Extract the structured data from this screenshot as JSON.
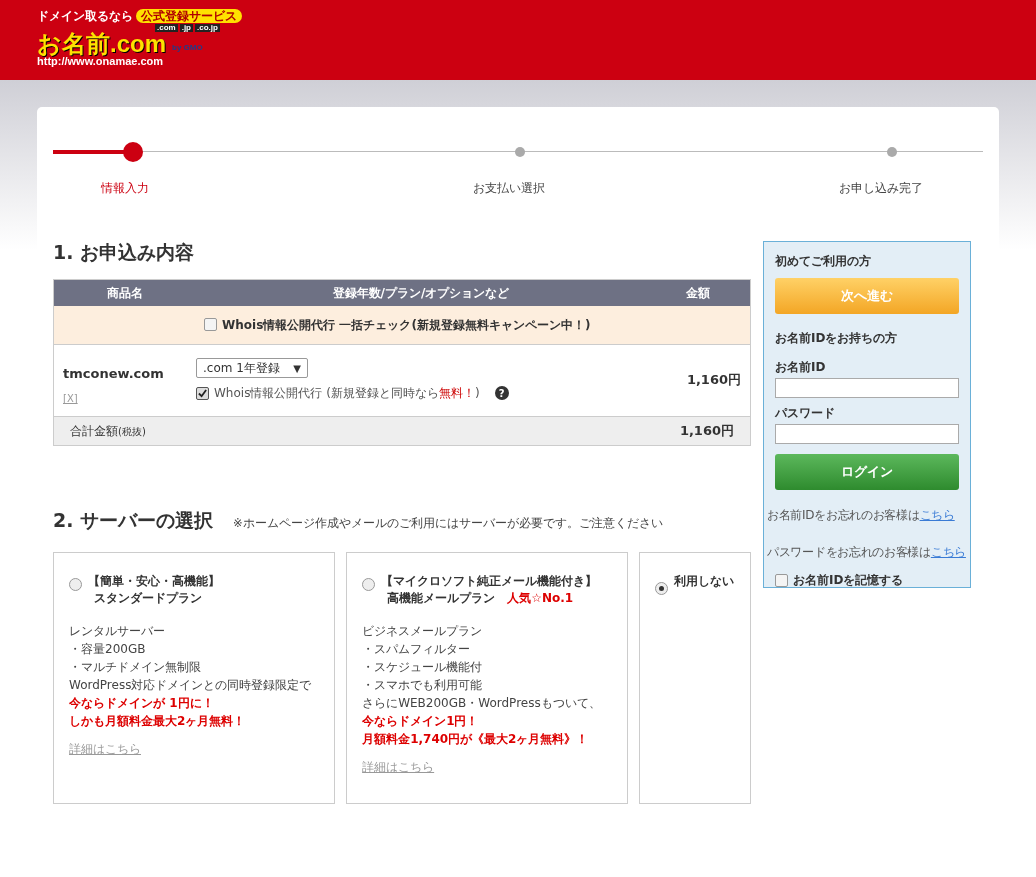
{
  "header": {
    "tagline": "ドメイン取るなら",
    "badge": "公式登録サービス",
    "tlds": [
      ".com",
      ".jp",
      ".co.jp"
    ],
    "logo": "お名前.com",
    "by": "by GMO",
    "url": "http://www.onamae.com"
  },
  "steps": [
    {
      "label": "情報入力",
      "selected": true
    },
    {
      "label": "お支払い選択",
      "selected": false
    },
    {
      "label": "お申し込み完了",
      "selected": false
    }
  ],
  "order": {
    "title": "1. お申込み内容",
    "columns": [
      "商品名",
      "登録年数/プラン/オプションなど",
      "金額"
    ],
    "bulk": {
      "label": "Whois情報公開代行 一括チェック(新規登録無料キャンペーン中！)",
      "checked": false
    },
    "item": {
      "domain": "tmconew.com",
      "remove": "[X]",
      "plan": ".com 1年登録",
      "plan_caret": "▼",
      "help": "?",
      "whois": {
        "label": "Whois情報公開代行 (新規登録と同時なら",
        "free": "無料！",
        "close": ")",
        "checked": true
      },
      "price": "1,160円"
    },
    "total": {
      "label": "合計金額",
      "note": "(税抜)",
      "value": "1,160円"
    }
  },
  "server": {
    "title": "2. サーバーの選択",
    "note": "※ホームページ作成やメールのご利用にはサーバーが必要です。ご注意ください",
    "plans": [
      {
        "selected": false,
        "heading": [
          "【簡単・安心・高機能】",
          "スタンダードプラン"
        ],
        "lines": [
          {
            "text": "レンタルサーバー",
            "kind": "plain"
          },
          {
            "text": "・容量200GB",
            "kind": "plain"
          },
          {
            "text": "・マルチドメイン無制限",
            "kind": "plain"
          },
          {
            "text": "WordPress対応ドメインとの同時登録限定で",
            "kind": "plain"
          },
          {
            "text": "今ならドメインが 1円に！",
            "kind": "highlight"
          },
          {
            "text": "しかも月額料金最大2ヶ月無料！",
            "kind": "highlight"
          }
        ],
        "link": "詳細はこちら"
      },
      {
        "selected": false,
        "heading": [
          "【マイクロソフト純正メール機能付き】",
          "高機能メールプラン"
        ],
        "badge": "人気☆No.1",
        "lines": [
          {
            "text": "ビジネスメールプラン",
            "kind": "plain"
          },
          {
            "text": "・スパムフィルター",
            "kind": "plain"
          },
          {
            "text": "・スケジュール機能付",
            "kind": "plain"
          },
          {
            "text": "・スマホでも利用可能",
            "kind": "plain"
          },
          {
            "text": "さらにWEB200GB・WordPressもついて、",
            "kind": "plain"
          },
          {
            "text": "今ならドメイン1円！",
            "kind": "highlight"
          },
          {
            "text": "月額料金1,740円が《最大2ヶ月無料》！",
            "kind": "highlight"
          }
        ],
        "link": "詳細はこちら"
      },
      {
        "selected": true,
        "heading": [
          "利用しない"
        ]
      }
    ]
  },
  "sidebar": {
    "new_title": "初めてご利用の方",
    "next": "次へ進む",
    "member_title": "お名前IDをお持ちの方",
    "id_label": "お名前ID",
    "password_label": "パスワード",
    "login": "ログイン",
    "forgot": [
      {
        "text": "お名前IDをお忘れのお客様は",
        "link": "こちら"
      },
      {
        "text": "パスワードをお忘れのお客様は",
        "link": "こちら"
      }
    ],
    "remember": {
      "label": "お名前IDを記憶する",
      "checked": false
    }
  }
}
